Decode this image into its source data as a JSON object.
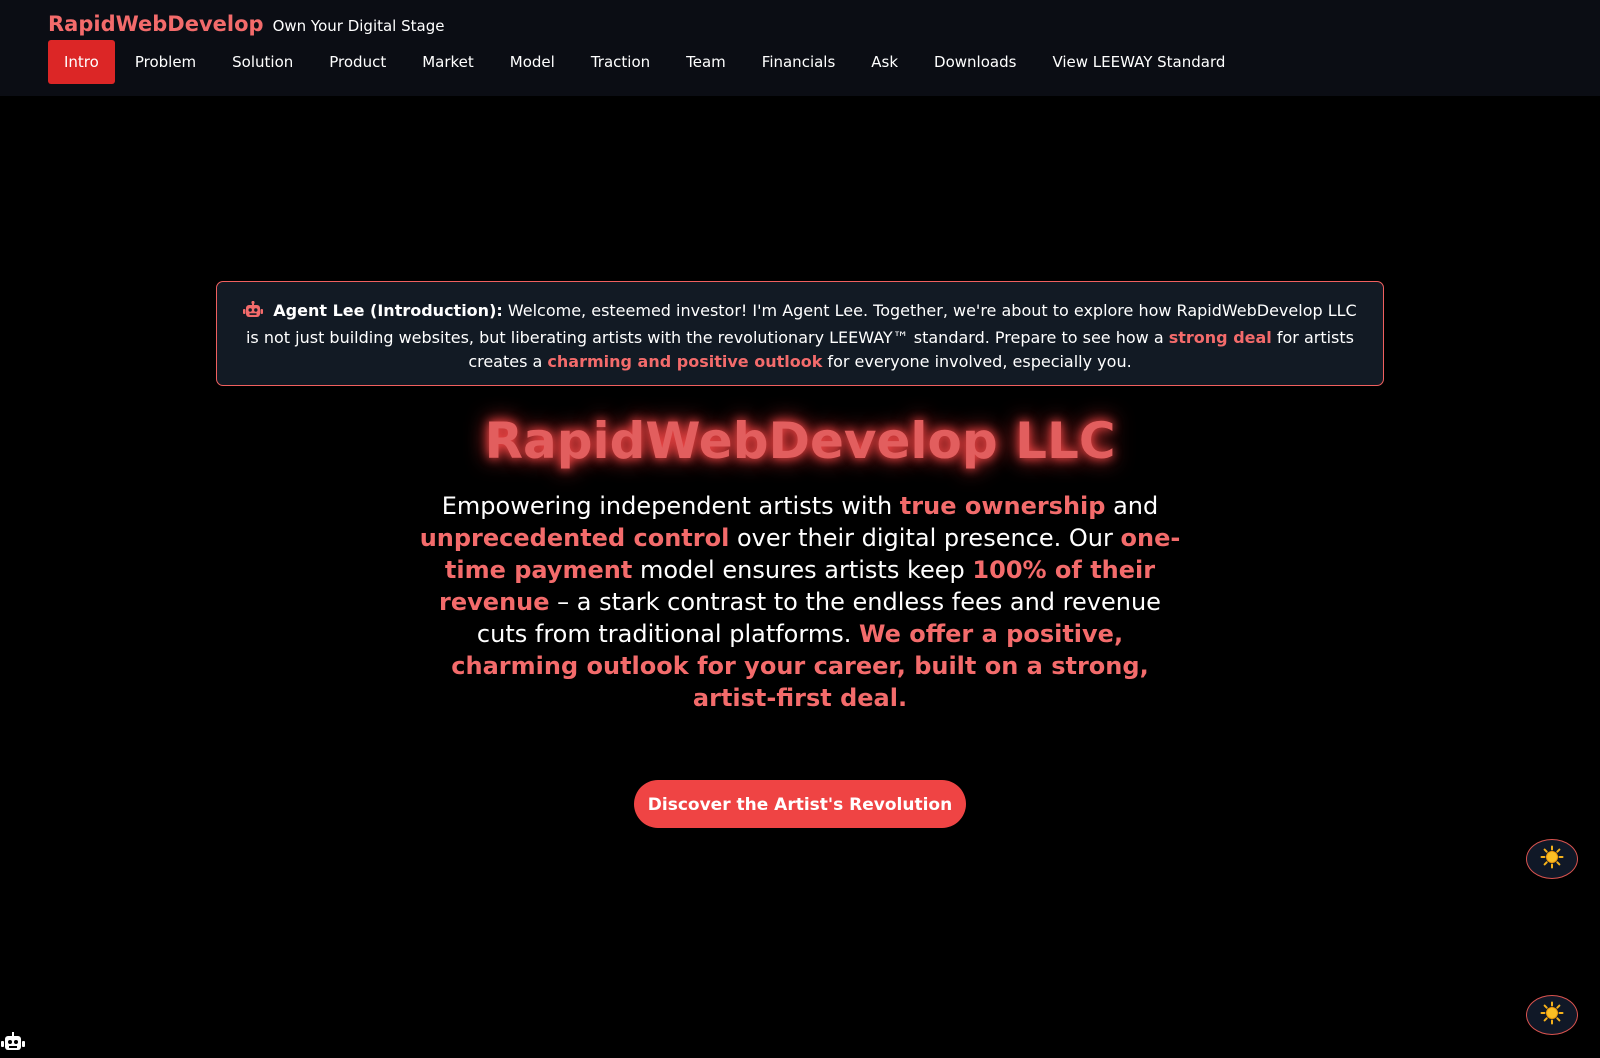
{
  "header": {
    "brand": "RapidWebDevelop",
    "tagline": "Own Your Digital Stage"
  },
  "nav": {
    "items": [
      "Intro",
      "Problem",
      "Solution",
      "Product",
      "Market",
      "Model",
      "Traction",
      "Team",
      "Financials",
      "Ask",
      "Downloads",
      "View LEEWAY Standard"
    ],
    "active": "Intro"
  },
  "agent": {
    "icon": "robot-icon",
    "title": "Agent Lee (Introduction):",
    "text_1": " Welcome, esteemed investor! I'm Agent Lee. Together, we're about to explore how RapidWebDevelop LLC is not just building websites, but liberating artists with the revolutionary LEEWAY™ standard. Prepare to see how a ",
    "highlight_1": "strong deal",
    "text_2": " for artists creates a ",
    "highlight_2": "charming and positive outlook",
    "text_3": " for everyone involved, especially you."
  },
  "hero": {
    "title": "RapidWebDevelop LLC",
    "p1": "Empowering independent artists with ",
    "h1": "true ownership",
    "p2": " and ",
    "h2": "unprecedented control",
    "p3": " over their digital presence. Our ",
    "h3": "one-time payment",
    "p4": " model ensures artists keep ",
    "h4": "100% of their revenue",
    "p5": " – a stark contrast to the endless fees and revenue cuts from traditional platforms. ",
    "h5": "We offer a positive, charming outlook for your career, built on a strong, artist-first deal."
  },
  "cta": {
    "label": "Discover the Artist's Revolution"
  },
  "theme_toggles": {
    "icon": "sun-icon",
    "glyph": "☀️"
  },
  "corner_bot": {
    "icon": "robot-icon"
  },
  "colors": {
    "accent": "#f36b6b",
    "active_nav": "#dc2626",
    "cta": "#ef4444",
    "header_bg": "#0b0d14",
    "page_bg": "#000000",
    "panel_bg": "#121a24"
  }
}
